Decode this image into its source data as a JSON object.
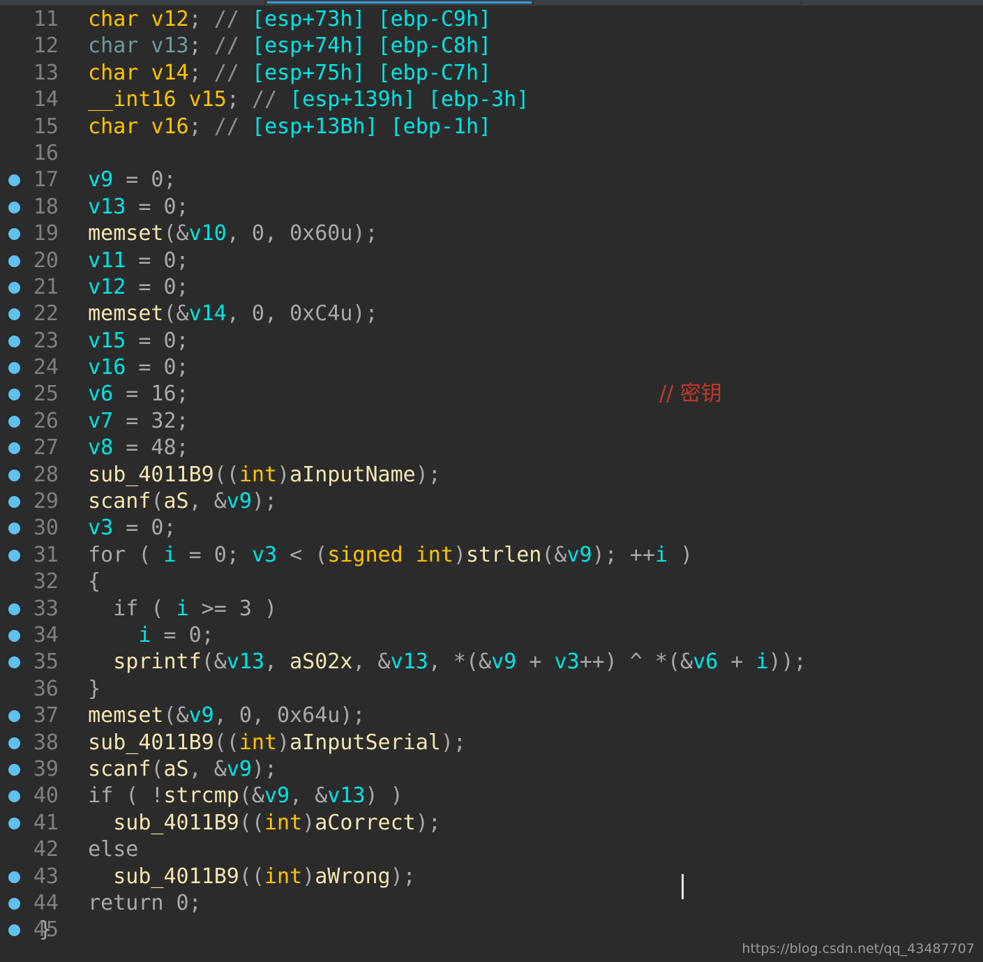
{
  "window": {
    "top_bar": {
      "active_tab_underline_color": "#2f9ee0",
      "chrome_color": "#3c3f41"
    }
  },
  "editor": {
    "background_color": "#2b2b2b",
    "breakpoint_color": "#5ec1f0",
    "caret_visible": true,
    "colors": {
      "keyword": "#ffc400",
      "variable": "#00e5e5",
      "function": "#f3e6b3",
      "plain": "#a9a9a9",
      "comment": "#8f8f8f",
      "location": "#00e5e5",
      "red_comment": "#c0392b",
      "line_number": "#808080"
    },
    "lines": [
      {
        "number": "11",
        "breakpoint": false,
        "tokens": [
          {
            "text": "  ",
            "style": "plain"
          },
          {
            "text": "char",
            "style": "kw"
          },
          {
            "text": " ",
            "style": "plain"
          },
          {
            "text": "v12",
            "style": "decl"
          },
          {
            "text": "; ",
            "style": "plain"
          },
          {
            "text": "//",
            "style": "cmt"
          },
          {
            "text": " ",
            "style": "plain"
          },
          {
            "text": "[esp+73h] [ebp-C9h]",
            "style": "loc"
          }
        ]
      },
      {
        "number": "12",
        "breakpoint": false,
        "tokens": [
          {
            "text": "  ",
            "style": "plain"
          },
          {
            "text": "char v13",
            "style": "hl"
          },
          {
            "text": "; ",
            "style": "plain"
          },
          {
            "text": "//",
            "style": "cmt"
          },
          {
            "text": " ",
            "style": "plain"
          },
          {
            "text": "[esp+74h] [ebp-C8h]",
            "style": "loc"
          }
        ]
      },
      {
        "number": "13",
        "breakpoint": false,
        "tokens": [
          {
            "text": "  ",
            "style": "plain"
          },
          {
            "text": "char",
            "style": "kw"
          },
          {
            "text": " ",
            "style": "plain"
          },
          {
            "text": "v14",
            "style": "decl"
          },
          {
            "text": "; ",
            "style": "plain"
          },
          {
            "text": "//",
            "style": "cmt"
          },
          {
            "text": " ",
            "style": "plain"
          },
          {
            "text": "[esp+75h] [ebp-C7h]",
            "style": "loc"
          }
        ]
      },
      {
        "number": "14",
        "breakpoint": false,
        "tokens": [
          {
            "text": "  ",
            "style": "plain"
          },
          {
            "text": "__int16",
            "style": "kw"
          },
          {
            "text": " ",
            "style": "plain"
          },
          {
            "text": "v15",
            "style": "decl"
          },
          {
            "text": "; ",
            "style": "plain"
          },
          {
            "text": "//",
            "style": "cmt"
          },
          {
            "text": " ",
            "style": "plain"
          },
          {
            "text": "[esp+139h] [ebp-3h]",
            "style": "loc"
          }
        ]
      },
      {
        "number": "15",
        "breakpoint": false,
        "tokens": [
          {
            "text": "  ",
            "style": "plain"
          },
          {
            "text": "char",
            "style": "kw"
          },
          {
            "text": " ",
            "style": "plain"
          },
          {
            "text": "v16",
            "style": "decl"
          },
          {
            "text": "; ",
            "style": "plain"
          },
          {
            "text": "//",
            "style": "cmt"
          },
          {
            "text": " ",
            "style": "plain"
          },
          {
            "text": "[esp+13Bh] [ebp-1h]",
            "style": "loc"
          }
        ]
      },
      {
        "number": "16",
        "breakpoint": false,
        "tokens": []
      },
      {
        "number": "17",
        "breakpoint": true,
        "tokens": [
          {
            "text": "  ",
            "style": "plain"
          },
          {
            "text": "v9",
            "style": "var"
          },
          {
            "text": " = 0;",
            "style": "plain"
          }
        ]
      },
      {
        "number": "18",
        "breakpoint": true,
        "tokens": [
          {
            "text": "  ",
            "style": "plain"
          },
          {
            "text": "v13",
            "style": "var"
          },
          {
            "text": " = 0;",
            "style": "plain"
          }
        ]
      },
      {
        "number": "19",
        "breakpoint": true,
        "tokens": [
          {
            "text": "  ",
            "style": "plain"
          },
          {
            "text": "memset",
            "style": "fn"
          },
          {
            "text": "(&",
            "style": "plain"
          },
          {
            "text": "v10",
            "style": "var"
          },
          {
            "text": ", 0, 0x60u);",
            "style": "plain"
          }
        ]
      },
      {
        "number": "20",
        "breakpoint": true,
        "tokens": [
          {
            "text": "  ",
            "style": "plain"
          },
          {
            "text": "v11",
            "style": "var"
          },
          {
            "text": " = 0;",
            "style": "plain"
          }
        ]
      },
      {
        "number": "21",
        "breakpoint": true,
        "tokens": [
          {
            "text": "  ",
            "style": "plain"
          },
          {
            "text": "v12",
            "style": "var"
          },
          {
            "text": " = 0;",
            "style": "plain"
          }
        ]
      },
      {
        "number": "22",
        "breakpoint": true,
        "tokens": [
          {
            "text": "  ",
            "style": "plain"
          },
          {
            "text": "memset",
            "style": "fn"
          },
          {
            "text": "(&",
            "style": "plain"
          },
          {
            "text": "v14",
            "style": "var"
          },
          {
            "text": ", 0, 0xC4u);",
            "style": "plain"
          }
        ]
      },
      {
        "number": "23",
        "breakpoint": true,
        "tokens": [
          {
            "text": "  ",
            "style": "plain"
          },
          {
            "text": "v15",
            "style": "var"
          },
          {
            "text": " = 0;",
            "style": "plain"
          }
        ]
      },
      {
        "number": "24",
        "breakpoint": true,
        "tokens": [
          {
            "text": "  ",
            "style": "plain"
          },
          {
            "text": "v16",
            "style": "var"
          },
          {
            "text": " = 0;",
            "style": "plain"
          }
        ]
      },
      {
        "number": "25",
        "breakpoint": true,
        "tokens": [
          {
            "text": "  ",
            "style": "plain"
          },
          {
            "text": "v6",
            "style": "var"
          },
          {
            "text": " = 16;",
            "style": "plain"
          }
        ],
        "side_comment": "// 密钥"
      },
      {
        "number": "26",
        "breakpoint": true,
        "tokens": [
          {
            "text": "  ",
            "style": "plain"
          },
          {
            "text": "v7",
            "style": "var"
          },
          {
            "text": " = 32;",
            "style": "plain"
          }
        ]
      },
      {
        "number": "27",
        "breakpoint": true,
        "tokens": [
          {
            "text": "  ",
            "style": "plain"
          },
          {
            "text": "v8",
            "style": "var"
          },
          {
            "text": " = 48;",
            "style": "plain"
          }
        ]
      },
      {
        "number": "28",
        "breakpoint": true,
        "tokens": [
          {
            "text": "  ",
            "style": "plain"
          },
          {
            "text": "sub_4011B9",
            "style": "fn"
          },
          {
            "text": "((",
            "style": "plain"
          },
          {
            "text": "int",
            "style": "kw"
          },
          {
            "text": ")",
            "style": "plain"
          },
          {
            "text": "aInputName",
            "style": "fn"
          },
          {
            "text": ");",
            "style": "plain"
          }
        ]
      },
      {
        "number": "29",
        "breakpoint": true,
        "tokens": [
          {
            "text": "  ",
            "style": "plain"
          },
          {
            "text": "scanf",
            "style": "fn"
          },
          {
            "text": "(",
            "style": "plain"
          },
          {
            "text": "aS",
            "style": "fn"
          },
          {
            "text": ", &",
            "style": "plain"
          },
          {
            "text": "v9",
            "style": "var"
          },
          {
            "text": ");",
            "style": "plain"
          }
        ]
      },
      {
        "number": "30",
        "breakpoint": true,
        "tokens": [
          {
            "text": "  ",
            "style": "plain"
          },
          {
            "text": "v3",
            "style": "var"
          },
          {
            "text": " = 0;",
            "style": "plain"
          }
        ]
      },
      {
        "number": "31",
        "breakpoint": true,
        "tokens": [
          {
            "text": "  for ( ",
            "style": "plain"
          },
          {
            "text": "i",
            "style": "var"
          },
          {
            "text": " = 0; ",
            "style": "plain"
          },
          {
            "text": "v3",
            "style": "var"
          },
          {
            "text": " < (",
            "style": "plain"
          },
          {
            "text": "signed int",
            "style": "kw"
          },
          {
            "text": ")",
            "style": "plain"
          },
          {
            "text": "strlen",
            "style": "fn"
          },
          {
            "text": "(&",
            "style": "plain"
          },
          {
            "text": "v9",
            "style": "var"
          },
          {
            "text": "); ++",
            "style": "plain"
          },
          {
            "text": "i",
            "style": "var"
          },
          {
            "text": " )",
            "style": "plain"
          }
        ]
      },
      {
        "number": "32",
        "breakpoint": false,
        "tokens": [
          {
            "text": "  {",
            "style": "plain"
          }
        ]
      },
      {
        "number": "33",
        "breakpoint": true,
        "tokens": [
          {
            "text": "    if ( ",
            "style": "plain"
          },
          {
            "text": "i",
            "style": "var"
          },
          {
            "text": " >= 3 )",
            "style": "plain"
          }
        ]
      },
      {
        "number": "34",
        "breakpoint": true,
        "tokens": [
          {
            "text": "      ",
            "style": "plain"
          },
          {
            "text": "i",
            "style": "var"
          },
          {
            "text": " = 0;",
            "style": "plain"
          }
        ]
      },
      {
        "number": "35",
        "breakpoint": true,
        "tokens": [
          {
            "text": "    ",
            "style": "plain"
          },
          {
            "text": "sprintf",
            "style": "fn"
          },
          {
            "text": "(&",
            "style": "plain"
          },
          {
            "text": "v13",
            "style": "var"
          },
          {
            "text": ", ",
            "style": "plain"
          },
          {
            "text": "aS02x",
            "style": "fn"
          },
          {
            "text": ", &",
            "style": "plain"
          },
          {
            "text": "v13",
            "style": "var"
          },
          {
            "text": ", *(&",
            "style": "plain"
          },
          {
            "text": "v9",
            "style": "var"
          },
          {
            "text": " + ",
            "style": "plain"
          },
          {
            "text": "v3",
            "style": "var"
          },
          {
            "text": "++) ^ *(&",
            "style": "plain"
          },
          {
            "text": "v6",
            "style": "var"
          },
          {
            "text": " + ",
            "style": "plain"
          },
          {
            "text": "i",
            "style": "var"
          },
          {
            "text": "));",
            "style": "plain"
          }
        ]
      },
      {
        "number": "36",
        "breakpoint": false,
        "tokens": [
          {
            "text": "  }",
            "style": "plain"
          }
        ]
      },
      {
        "number": "37",
        "breakpoint": true,
        "tokens": [
          {
            "text": "  ",
            "style": "plain"
          },
          {
            "text": "memset",
            "style": "fn"
          },
          {
            "text": "(&",
            "style": "plain"
          },
          {
            "text": "v9",
            "style": "var"
          },
          {
            "text": ", 0, 0x64u);",
            "style": "plain"
          }
        ]
      },
      {
        "number": "38",
        "breakpoint": true,
        "tokens": [
          {
            "text": "  ",
            "style": "plain"
          },
          {
            "text": "sub_4011B9",
            "style": "fn"
          },
          {
            "text": "((",
            "style": "plain"
          },
          {
            "text": "int",
            "style": "kw"
          },
          {
            "text": ")",
            "style": "plain"
          },
          {
            "text": "aInputSerial",
            "style": "fn"
          },
          {
            "text": ");",
            "style": "plain"
          }
        ]
      },
      {
        "number": "39",
        "breakpoint": true,
        "tokens": [
          {
            "text": "  ",
            "style": "plain"
          },
          {
            "text": "scanf",
            "style": "fn"
          },
          {
            "text": "(",
            "style": "plain"
          },
          {
            "text": "aS",
            "style": "fn"
          },
          {
            "text": ", &",
            "style": "plain"
          },
          {
            "text": "v9",
            "style": "var"
          },
          {
            "text": ");",
            "style": "plain"
          }
        ]
      },
      {
        "number": "40",
        "breakpoint": true,
        "tokens": [
          {
            "text": "  if ( !",
            "style": "plain"
          },
          {
            "text": "strcmp",
            "style": "fn"
          },
          {
            "text": "(&",
            "style": "plain"
          },
          {
            "text": "v9",
            "style": "var"
          },
          {
            "text": ", &",
            "style": "plain"
          },
          {
            "text": "v13",
            "style": "var"
          },
          {
            "text": ") )",
            "style": "plain"
          }
        ]
      },
      {
        "number": "41",
        "breakpoint": true,
        "tokens": [
          {
            "text": "    ",
            "style": "plain"
          },
          {
            "text": "sub_4011B9",
            "style": "fn"
          },
          {
            "text": "((",
            "style": "plain"
          },
          {
            "text": "int",
            "style": "kw"
          },
          {
            "text": ")",
            "style": "plain"
          },
          {
            "text": "aCorrect",
            "style": "fn"
          },
          {
            "text": ");",
            "style": "plain"
          }
        ]
      },
      {
        "number": "42",
        "breakpoint": false,
        "tokens": [
          {
            "text": "  else",
            "style": "plain"
          }
        ]
      },
      {
        "number": "43",
        "breakpoint": true,
        "tokens": [
          {
            "text": "    ",
            "style": "plain"
          },
          {
            "text": "sub_4011B9",
            "style": "fn"
          },
          {
            "text": "((",
            "style": "plain"
          },
          {
            "text": "int",
            "style": "kw"
          },
          {
            "text": ")",
            "style": "plain"
          },
          {
            "text": "aWrong",
            "style": "fn"
          },
          {
            "text": ");",
            "style": "plain"
          }
        ]
      },
      {
        "number": "44",
        "breakpoint": true,
        "tokens": [
          {
            "text": "  return 0;",
            "style": "plain"
          }
        ]
      },
      {
        "number": "45",
        "breakpoint": true,
        "tokens": [
          {
            "text": "}",
            "style": "plain"
          }
        ],
        "no_indent": true
      }
    ]
  },
  "watermark": {
    "text": "https://blog.csdn.net/qq_43487707"
  }
}
